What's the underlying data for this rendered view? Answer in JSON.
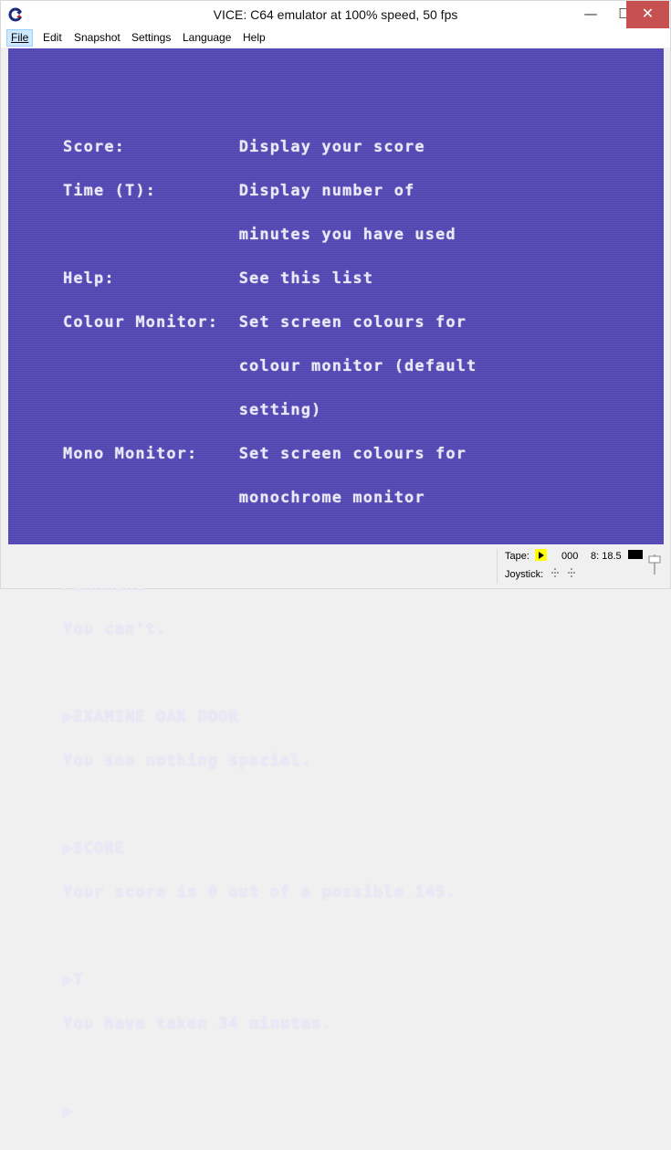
{
  "window": {
    "title": "VICE: C64 emulator at 100% speed, 50 fps",
    "controls": {
      "minimize": "—",
      "maximize": "☐",
      "close": "✕"
    }
  },
  "menubar": {
    "items": [
      {
        "label": "File",
        "active": true
      },
      {
        "label": "Edit"
      },
      {
        "label": "Snapshot"
      },
      {
        "label": "Settings"
      },
      {
        "label": "Language"
      },
      {
        "label": "Help"
      }
    ]
  },
  "screen": {
    "background_color": "#5549b8",
    "text_color": "#ebe8f7",
    "lines": [
      "Score:           Display your score",
      "Time (T):        Display number of",
      "                 minutes you have used",
      "Help:            See this list",
      "Colour Monitor:  Set screen colours for",
      "                 colour monitor (default",
      "                 setting)",
      "Mono Monitor:    Set screen colours for",
      "                 monochrome monitor",
      "",
      "▶EXAMINE",
      "You can't.",
      "",
      "▶EXAMINE OAK DOOR",
      "You see nothing special.",
      "",
      "▶SCORE",
      "Your score is 0 out of a possible 145.",
      "",
      "▶T",
      "You have taken 34 minutes.",
      "",
      "▶"
    ]
  },
  "statusbar": {
    "tape_label": "Tape:",
    "tape_counter": "000",
    "drive_status": "8: 18.5",
    "joystick_label": "Joystick:"
  }
}
